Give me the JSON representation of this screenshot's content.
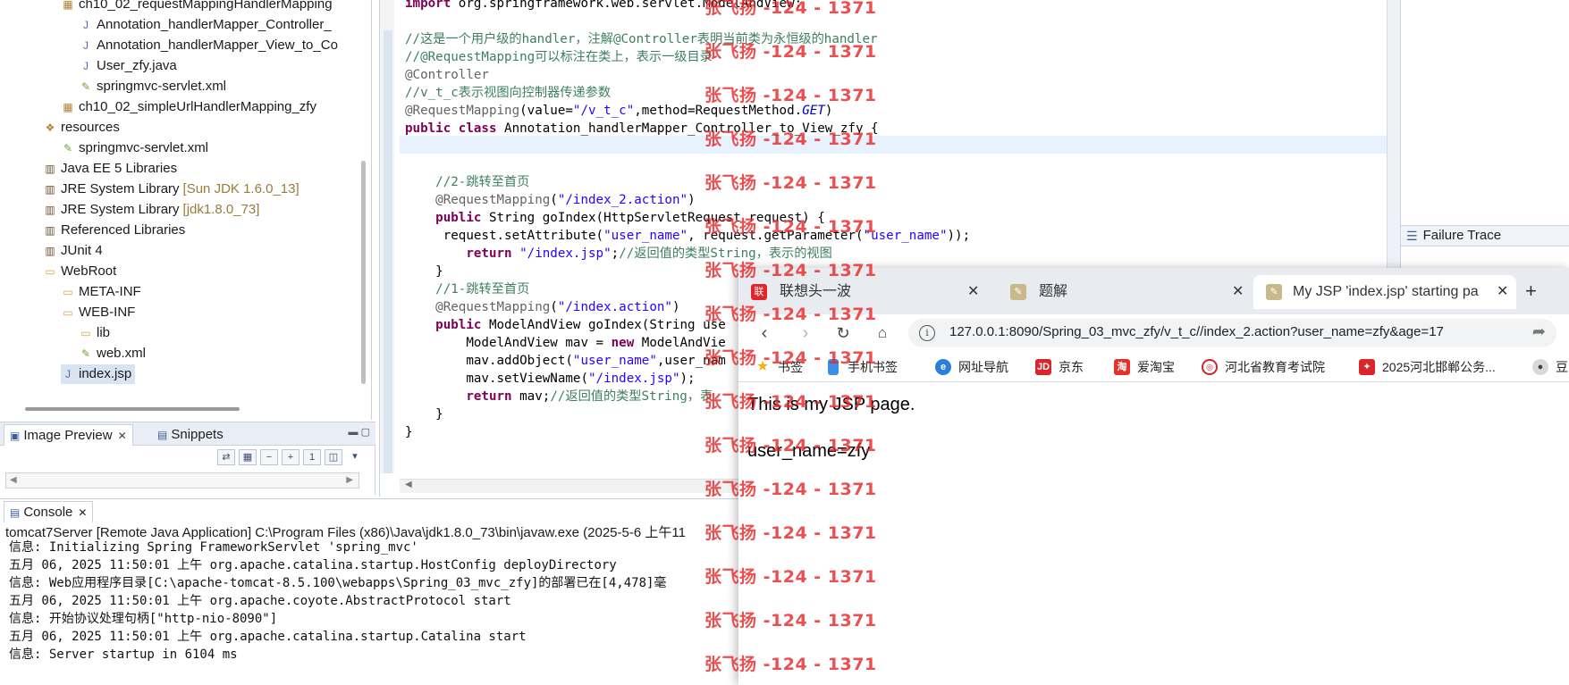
{
  "explorer": {
    "items": [
      {
        "label": "ch10_02_requestMappingHandlerMapping",
        "icon": "package-folder-icon"
      },
      {
        "label": "Annotation_handlerMapper_Controller_",
        "icon": "java-file-icon"
      },
      {
        "label": "Annotation_handlerMapper_View_to_Co",
        "icon": "java-file-icon"
      },
      {
        "label": "User_zfy.java",
        "icon": "java-file-icon"
      },
      {
        "label": "springmvc-servlet.xml",
        "icon": "xml-file-icon"
      },
      {
        "label": "ch10_02_simpleUrlHandlerMapping_zfy",
        "icon": "package-folder-icon"
      },
      {
        "label": "resources",
        "icon": "source-folder-icon"
      },
      {
        "label": "springmvc-servlet.xml",
        "icon": "xml-file-icon"
      },
      {
        "label": "Java EE 5 Libraries",
        "icon": "library-icon"
      },
      {
        "label": "JRE System Library",
        "extra": "[Sun JDK 1.6.0_13]",
        "icon": "library-icon"
      },
      {
        "label": "JRE System Library",
        "extra": "[jdk1.8.0_73]",
        "icon": "library-icon"
      },
      {
        "label": "Referenced Libraries",
        "icon": "library-icon"
      },
      {
        "label": "JUnit 4",
        "icon": "library-icon"
      },
      {
        "label": "WebRoot",
        "icon": "folder-icon"
      },
      {
        "label": "META-INF",
        "icon": "folder-icon"
      },
      {
        "label": "WEB-INF",
        "icon": "folder-icon"
      },
      {
        "label": "lib",
        "icon": "folder-icon"
      },
      {
        "label": "web.xml",
        "icon": "xml-file-icon"
      },
      {
        "label": "index.jsp",
        "icon": "jsp-file-icon",
        "selected": true
      }
    ]
  },
  "preview_panel": {
    "tabs": [
      {
        "label": "Image Preview",
        "active": true
      },
      {
        "label": "Snippets",
        "active": false
      }
    ]
  },
  "editor": {
    "lines": [
      {
        "parts": [
          [
            "kw",
            "import"
          ],
          [
            "",
            " org.springframework.web.servlet.ModelAndView;"
          ]
        ]
      },
      {
        "parts": []
      },
      {
        "parts": [
          [
            "cm",
            "//这是一个用户级的handler，注解@Controller表明当前类为永恒级的handler"
          ]
        ]
      },
      {
        "parts": [
          [
            "cm",
            "//@RequestMapping可以标注在类上，表示一级目录"
          ]
        ]
      },
      {
        "parts": [
          [
            "an",
            "@Controller"
          ]
        ]
      },
      {
        "parts": [
          [
            "cm",
            "//v_t_c表示视图向控制器传递参数"
          ]
        ]
      },
      {
        "parts": [
          [
            "an",
            "@RequestMapping"
          ],
          [
            "",
            "(value="
          ],
          [
            "st",
            "\"/v_t_c\""
          ],
          [
            "",
            ",method=RequestMethod."
          ],
          [
            "it",
            "GET"
          ],
          [
            "",
            ")"
          ]
        ]
      },
      {
        "parts": [
          [
            "kw",
            "public class"
          ],
          [
            "",
            " Annotation_handlerMapper_Controller_to_View_zfy {"
          ]
        ]
      },
      {
        "parts": []
      },
      {
        "parts": []
      },
      {
        "parts": [
          [
            "",
            "    "
          ],
          [
            "cm",
            "//2-跳转至首页"
          ]
        ]
      },
      {
        "parts": [
          [
            "",
            "    "
          ],
          [
            "an",
            "@RequestMapping"
          ],
          [
            "",
            "("
          ],
          [
            "st",
            "\"/index_2.action\""
          ],
          [
            "",
            ")"
          ]
        ]
      },
      {
        "parts": [
          [
            "",
            "    "
          ],
          [
            "kw",
            "public"
          ],
          [
            "",
            " String goIndex(HttpServletRequest request) {"
          ]
        ]
      },
      {
        "parts": [
          [
            "",
            "     request.setAttribute("
          ],
          [
            "st",
            "\"user_name\""
          ],
          [
            "",
            ", request.getParameter("
          ],
          [
            "st",
            "\"user_name\""
          ],
          [
            "",
            "));"
          ]
        ]
      },
      {
        "parts": [
          [
            "",
            "        "
          ],
          [
            "kw",
            "return"
          ],
          [
            "",
            " "
          ],
          [
            "st",
            "\"/index.jsp\""
          ],
          [
            "",
            ";"
          ],
          [
            "cm",
            "//返回值的类型String，表示的视图"
          ]
        ]
      },
      {
        "parts": [
          [
            "",
            "    }"
          ]
        ]
      },
      {
        "parts": [
          [
            "",
            "    "
          ],
          [
            "cm",
            "//1-跳转至首页"
          ]
        ]
      },
      {
        "parts": [
          [
            "",
            "    "
          ],
          [
            "an",
            "@RequestMapping"
          ],
          [
            "",
            "("
          ],
          [
            "st",
            "\"/index.action\""
          ],
          [
            "",
            ")"
          ]
        ]
      },
      {
        "parts": [
          [
            "",
            "    "
          ],
          [
            "kw",
            "public"
          ],
          [
            "",
            " ModelAndView goIndex(String use"
          ]
        ]
      },
      {
        "parts": [
          [
            "",
            "        ModelAndView mav = "
          ],
          [
            "kw",
            "new"
          ],
          [
            "",
            " ModelAndVie"
          ]
        ]
      },
      {
        "parts": [
          [
            "",
            "        mav.addObject("
          ],
          [
            "st",
            "\"user_name\""
          ],
          [
            "",
            ",user_nam"
          ]
        ]
      },
      {
        "parts": [
          [
            "",
            "        mav.setViewName("
          ],
          [
            "st",
            "\"/index.jsp\""
          ],
          [
            "",
            ");"
          ]
        ]
      },
      {
        "parts": [
          [
            "",
            "        "
          ],
          [
            "kw",
            "return"
          ],
          [
            "",
            " mav;"
          ],
          [
            "cm",
            "//返回值的类型String，表"
          ]
        ]
      },
      {
        "parts": [
          [
            "",
            "    }"
          ]
        ]
      },
      {
        "parts": [
          [
            "",
            "}"
          ]
        ]
      }
    ]
  },
  "right_panel": {
    "failure_trace_label": "Failure Trace"
  },
  "console": {
    "tab_label": "Console",
    "description": "tomcat7Server [Remote Java Application] C:\\Program Files (x86)\\Java\\jdk1.8.0_73\\bin\\javaw.exe (2025-5-6 上午11",
    "lines": [
      "信息: Initializing Spring FrameworkServlet 'spring_mvc'",
      "五月 06, 2025 11:50:01 上午 org.apache.catalina.startup.HostConfig deployDirectory",
      "信息: Web应用程序目录[C:\\apache-tomcat-8.5.100\\webapps\\Spring_03_mvc_zfy]的部署已在[4,478]毫",
      "五月 06, 2025 11:50:01 上午 org.apache.coyote.AbstractProtocol start",
      "信息: 开始协议处理句柄[\"http-nio-8090\"]",
      "五月 06, 2025 11:50:01 上午 org.apache.catalina.startup.Catalina start",
      "信息: Server startup in 6104 ms"
    ]
  },
  "browser": {
    "tabs": [
      {
        "title": "联想头一波",
        "active": false,
        "color": "#e0262b"
      },
      {
        "title": "题解",
        "active": false,
        "color": "#7a6a3a"
      },
      {
        "title": "My JSP 'index.jsp' starting pa",
        "active": true,
        "color": "#7a6a3a"
      }
    ],
    "url": "127.0.0.1:8090/Spring_03_mvc_zfy/v_t_c//index_2.action?user_name=zfy&age=17",
    "bookmarks": [
      {
        "label": "书签",
        "icon": "star-icon",
        "color": "#f2b01e"
      },
      {
        "label": "手机书签",
        "icon": "phone-icon",
        "color": "#3d8ee8"
      },
      {
        "label": "网址导航",
        "icon": "ie-icon",
        "color": "#2a7fd8"
      },
      {
        "label": "京东",
        "icon": "jd-icon",
        "color": "#d8262b"
      },
      {
        "label": "爱淘宝",
        "icon": "taobao-icon",
        "color": "#e3322c"
      },
      {
        "label": "河北省教育考试院",
        "icon": "exam-icon",
        "color": "#c8282b"
      },
      {
        "label": "2025河北邯郸公务...",
        "icon": "gov-icon",
        "color": "#d8262b"
      },
      {
        "label": "豆",
        "icon": "avatar-icon",
        "color": "#555555"
      }
    ],
    "page": {
      "line1": "This is my JSP page.",
      "line2": "user_name=zfy"
    }
  },
  "watermark": {
    "text": "张飞扬 -124 - 1371",
    "color": "#e82828"
  }
}
